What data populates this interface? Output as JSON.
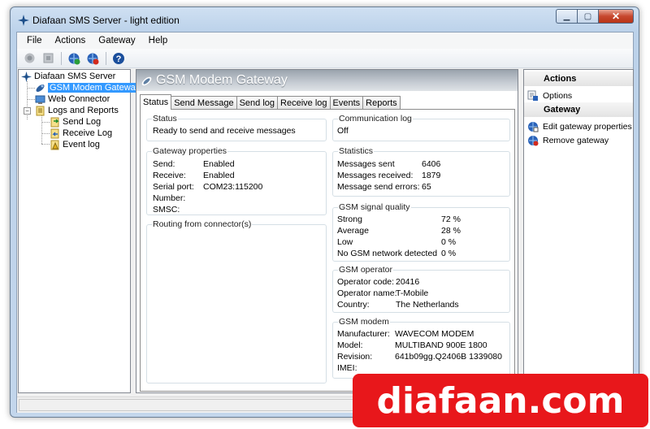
{
  "window": {
    "title": "Diafaan SMS Server - light edition"
  },
  "menu": [
    "File",
    "Actions",
    "Gateway",
    "Help"
  ],
  "tree": {
    "root": "Diafaan SMS Server",
    "gsm_gateway": "GSM Modem Gateway",
    "web_connector": "Web Connector",
    "logs": "Logs and Reports",
    "send_log": "Send Log",
    "receive_log": "Receive Log",
    "event_log": "Event log"
  },
  "main": {
    "heading": "GSM Modem Gateway",
    "tabs": [
      "Status",
      "Send Message",
      "Send log",
      "Receive log",
      "Events",
      "Reports"
    ],
    "status": {
      "caption": "Status",
      "text": "Ready to send and receive messages"
    },
    "gateway": {
      "caption": "Gateway properties",
      "send_label": "Send:",
      "send_value": "Enabled",
      "receive_label": "Receive:",
      "receive_value": "Enabled",
      "port_label": "Serial port:",
      "port_value": "COM23:115200",
      "number_label": "Number:",
      "smsc_label": "SMSC:"
    },
    "routing": {
      "caption": "Routing from connector(s)"
    },
    "comm_log": {
      "caption": "Communication log",
      "value": "Off"
    },
    "statistics": {
      "caption": "Statistics",
      "sent_label": "Messages sent",
      "sent_value": "6406",
      "received_label": "Messages received:",
      "received_value": "1879",
      "errors_label": "Message send errors:",
      "errors_value": "65"
    },
    "signal": {
      "caption": "GSM signal quality",
      "strong_label": "Strong",
      "strong_value": "72 %",
      "average_label": "Average",
      "average_value": "28 %",
      "low_label": "Low",
      "low_value": "0 %",
      "none_label": "No GSM network detected",
      "none_value": "0 %"
    },
    "operator": {
      "caption": "GSM operator",
      "code_label": "Operator code:",
      "code_value": "20416",
      "name_label": "Operator name:",
      "name_value": "T-Mobile",
      "country_label": "Country:",
      "country_value": "The Netherlands"
    },
    "modem": {
      "caption": "GSM modem",
      "manufacturer_label": "Manufacturer:",
      "manufacturer_value": "WAVECOM MODEM",
      "model_label": "Model:",
      "model_value": "MULTIBAND  900E  1800",
      "revision_label": "Revision:",
      "revision_value": "641b09gg.Q2406B 1339080",
      "imei_label": "IMEI:"
    }
  },
  "actions": {
    "header": "Actions",
    "options": "Options",
    "gateway_header": "Gateway",
    "edit": "Edit gateway properties",
    "remove": "Remove gateway"
  },
  "watermark": "diafaan.com",
  "colors": {
    "selection": "#3399ff",
    "watermark_bg": "#e8171b",
    "close_button": "#c7472e"
  }
}
